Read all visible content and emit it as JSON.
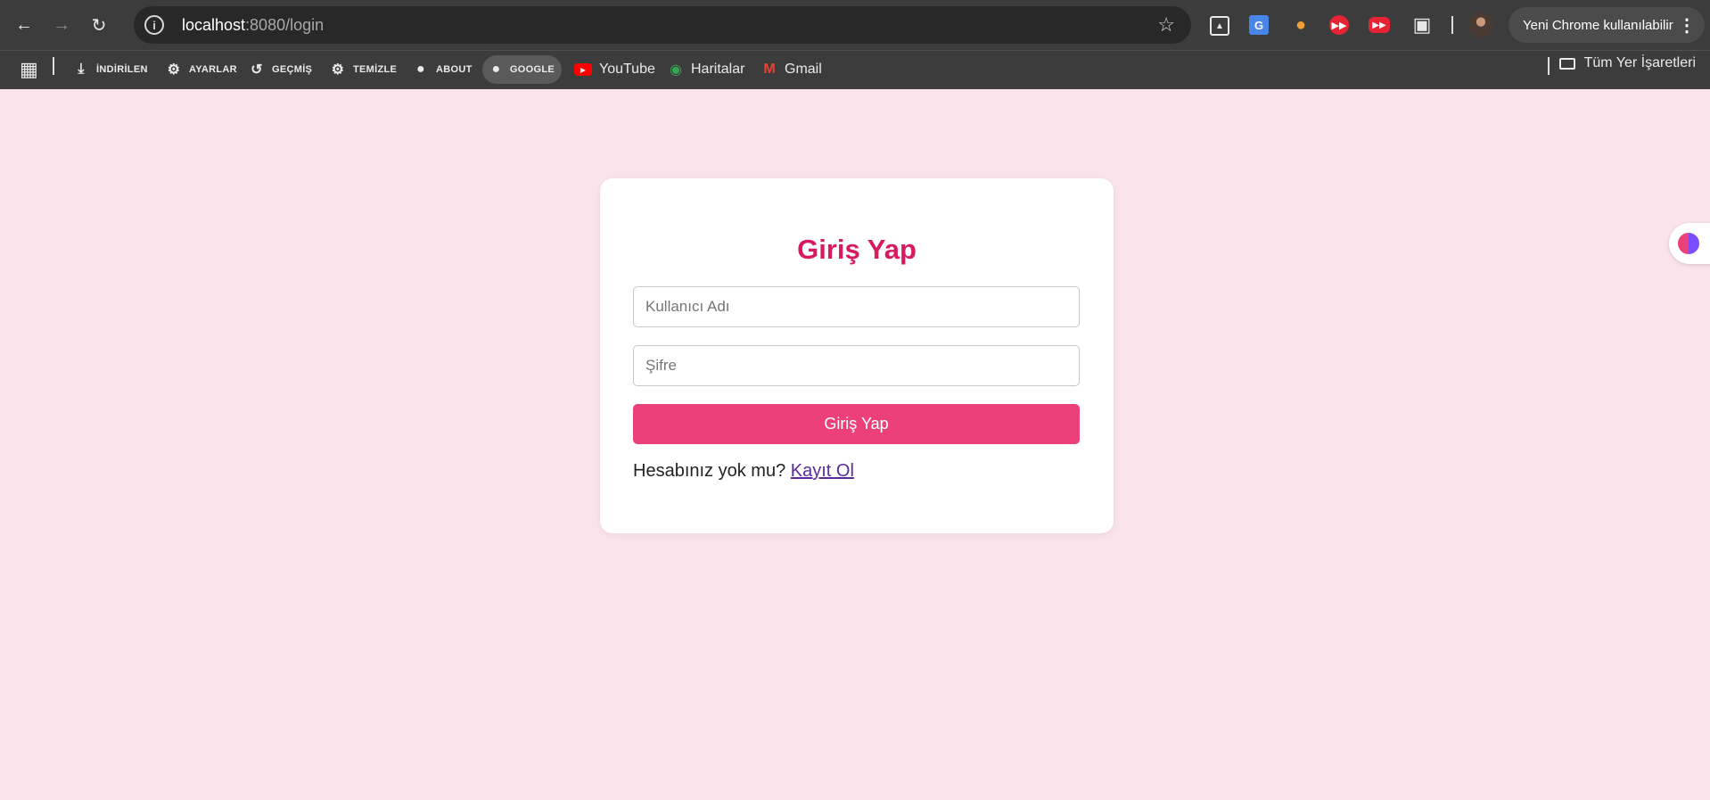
{
  "browser": {
    "url_host": "localhost",
    "url_rest": ":8080/login",
    "update_label": "Yeni Chrome kullanılabilir"
  },
  "bookmarks": {
    "items": [
      {
        "label": "İNDİRİLEN",
        "icon": "download-icon"
      },
      {
        "label": "AYARLAR",
        "icon": "gear-icon"
      },
      {
        "label": "GEÇMİŞ",
        "icon": "history-icon"
      },
      {
        "label": "TEMİZLE",
        "icon": "gear-icon"
      },
      {
        "label": "ABOUT",
        "icon": "globe-icon"
      },
      {
        "label": "GOOGLE",
        "icon": "globe-icon"
      },
      {
        "label": "YouTube",
        "icon": "youtube-icon"
      },
      {
        "label": "Haritalar",
        "icon": "maps-icon"
      },
      {
        "label": "Gmail",
        "icon": "gmail-icon"
      }
    ],
    "all_label": "Tüm Yer İşaretleri"
  },
  "login": {
    "title": "Giriş Yap",
    "username_placeholder": "Kullanıcı Adı",
    "password_placeholder": "Şifre",
    "submit_label": "Giriş Yap",
    "signup_prompt": "Hesabınız yok mu?",
    "signup_link": "Kayıt Ol"
  },
  "colors": {
    "page_bg": "#fae3eb",
    "title": "#d81b60",
    "button": "#ec407a",
    "link": "#5b2a9e"
  }
}
